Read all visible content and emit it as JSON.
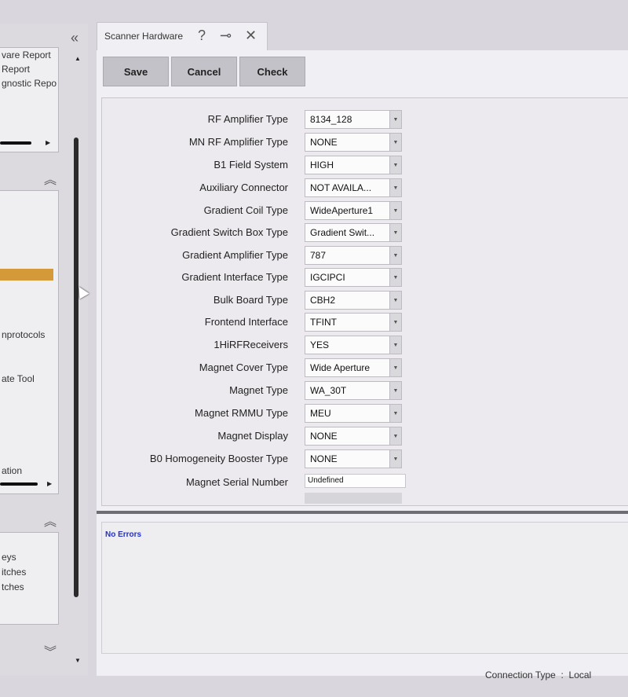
{
  "sidebar": {
    "top_items": [
      "vare Report",
      "Report",
      "gnostic Repo"
    ],
    "mid_items": [
      "nprotocols",
      "ate Tool",
      "ation"
    ],
    "bottom_items": [
      "eys",
      "itches",
      "tches"
    ]
  },
  "tab": {
    "title": "Scanner Hardware"
  },
  "toolbar": {
    "save": "Save",
    "cancel": "Cancel",
    "check": "Check"
  },
  "fields": [
    {
      "label": "RF Amplifier Type",
      "value": "8134_128"
    },
    {
      "label": "MN RF Amplifier Type",
      "value": "NONE"
    },
    {
      "label": "B1 Field System",
      "value": "HIGH"
    },
    {
      "label": "Auxiliary Connector",
      "value": "NOT AVAILA..."
    },
    {
      "label": "Gradient Coil Type",
      "value": "WideAperture1"
    },
    {
      "label": "Gradient Switch Box Type",
      "value": "Gradient Swit..."
    },
    {
      "label": "Gradient Amplifier Type",
      "value": "787"
    },
    {
      "label": "Gradient Interface Type",
      "value": "IGCIPCI"
    },
    {
      "label": "Bulk Board Type",
      "value": "CBH2"
    },
    {
      "label": "Frontend Interface",
      "value": "TFINT"
    },
    {
      "label": "1HiRFReceivers",
      "value": "YES"
    },
    {
      "label": "Magnet Cover Type",
      "value": "Wide Aperture"
    },
    {
      "label": "Magnet Type",
      "value": "WA_30T"
    },
    {
      "label": "Magnet RMMU Type",
      "value": "MEU"
    },
    {
      "label": "Magnet Display",
      "value": "NONE"
    },
    {
      "label": "B0 Homogeneity Booster Type",
      "value": "NONE"
    }
  ],
  "serial": {
    "label": "Magnet Serial Number",
    "value": "Undefined"
  },
  "messages": {
    "text": "No Errors"
  },
  "status": {
    "label": "Connection Type",
    "separator": ":",
    "value": "Local"
  }
}
